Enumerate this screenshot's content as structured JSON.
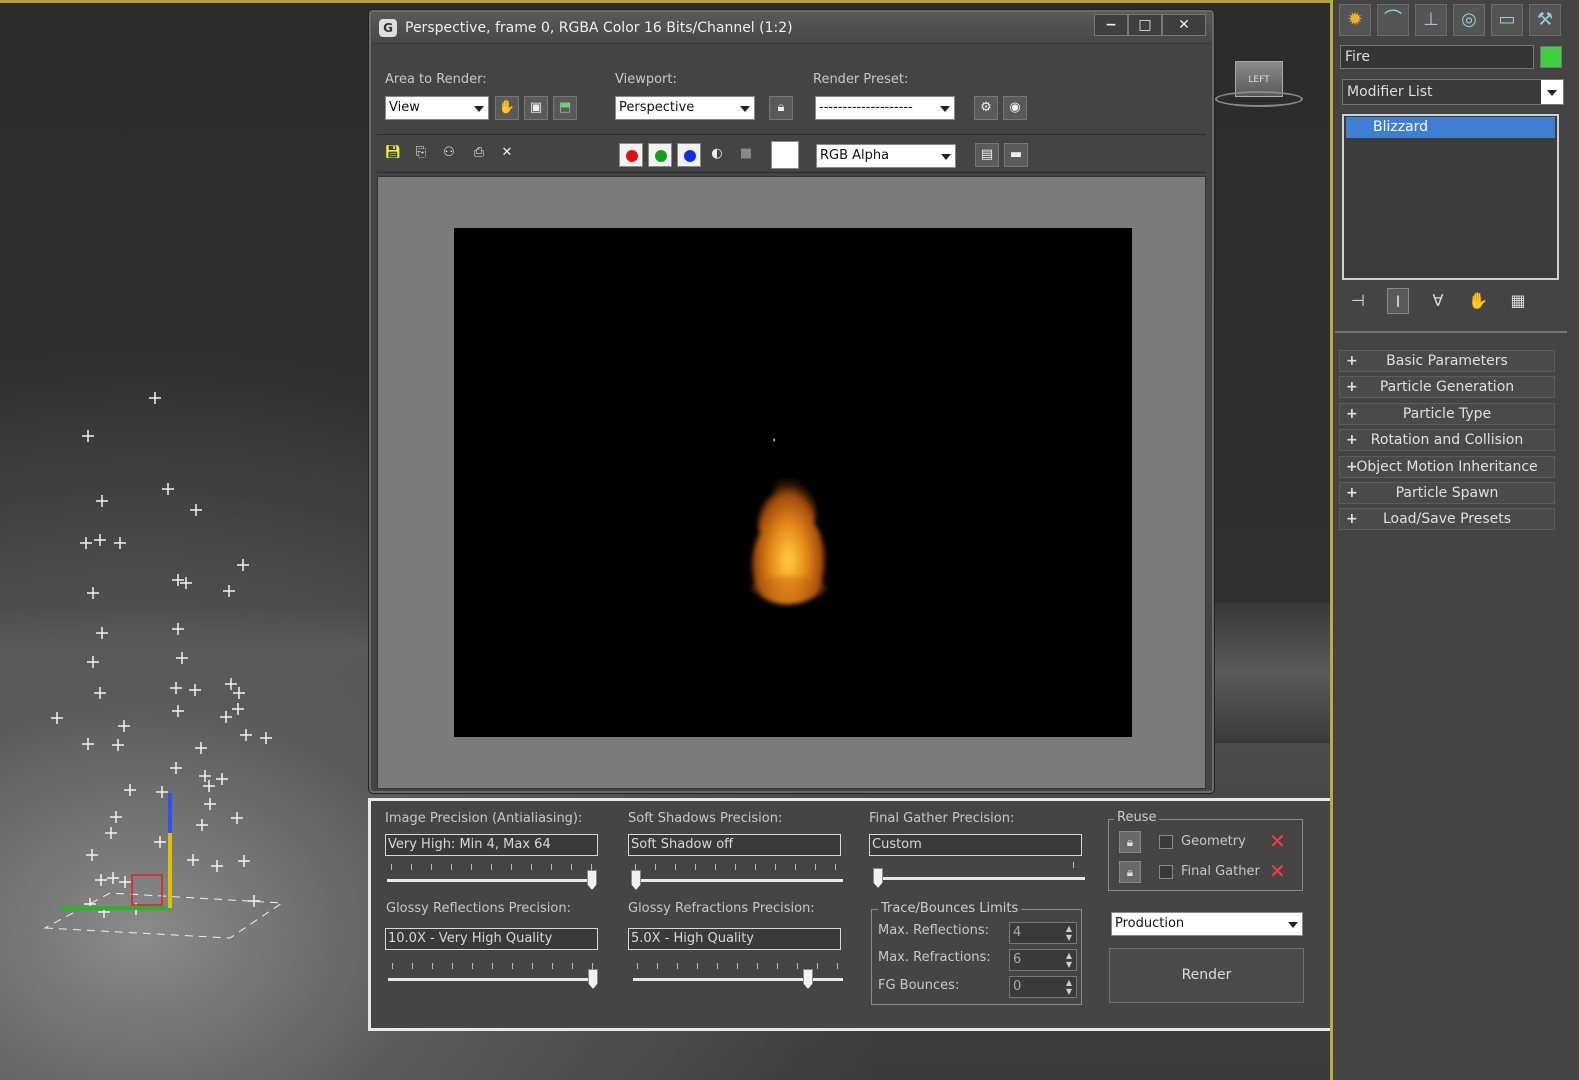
{
  "render_window": {
    "title": "Perspective, frame 0, RGBA Color 16 Bits/Channel (1:2)",
    "area_to_render_label": "Area to Render:",
    "area_to_render_value": "View",
    "viewport_label": "Viewport:",
    "viewport_value": "Perspective",
    "render_preset_label": "Render Preset:",
    "render_preset_value": "--------------------",
    "channel_value": "RGB Alpha",
    "colors": {
      "red": "#e01010",
      "green": "#10a020",
      "blue": "#1030e0"
    }
  },
  "viewcube": {
    "label": "LEFT"
  },
  "precision": {
    "image_label": "Image Precision (Antialiasing):",
    "image_value": "Very High: Min 4, Max 64",
    "image_level": 1.0,
    "soft_shadows_label": "Soft Shadows Precision:",
    "soft_shadows_value": "Soft Shadow off",
    "soft_shadows_level": 0.0,
    "final_gather_label": "Final Gather Precision:",
    "final_gather_value": "Custom",
    "final_gather_level": 0.0,
    "glossy_refl_label": "Glossy Reflections Precision:",
    "glossy_refl_value": "10.0X - Very High Quality",
    "glossy_refl_level": 1.0,
    "glossy_refr_label": "Glossy Refractions Precision:",
    "glossy_refr_value": "5.0X - High Quality",
    "glossy_refr_level": 0.85
  },
  "reuse": {
    "title": "Reuse",
    "geometry_label": "Geometry",
    "final_gather_label": "Final Gather"
  },
  "trace": {
    "title": "Trace/Bounces Limits",
    "max_reflections_label": "Max. Reflections:",
    "max_reflections_value": "4",
    "max_refractions_label": "Max. Refractions:",
    "max_refractions_value": "6",
    "fg_bounces_label": "FG Bounces:",
    "fg_bounces_value": "0"
  },
  "render": {
    "mode_value": "Production",
    "button_label": "Render"
  },
  "command_panel": {
    "object_name": "Fire",
    "object_color": "#3ecf3e",
    "modifier_list_label": "Modifier List",
    "stack_items": [
      "Blizzard"
    ],
    "rollouts": [
      "Basic Parameters",
      "Particle Generation",
      "Particle Type",
      "Rotation and Collision",
      "Object Motion Inheritance",
      "Particle Spawn",
      "Load/Save Presets"
    ]
  }
}
